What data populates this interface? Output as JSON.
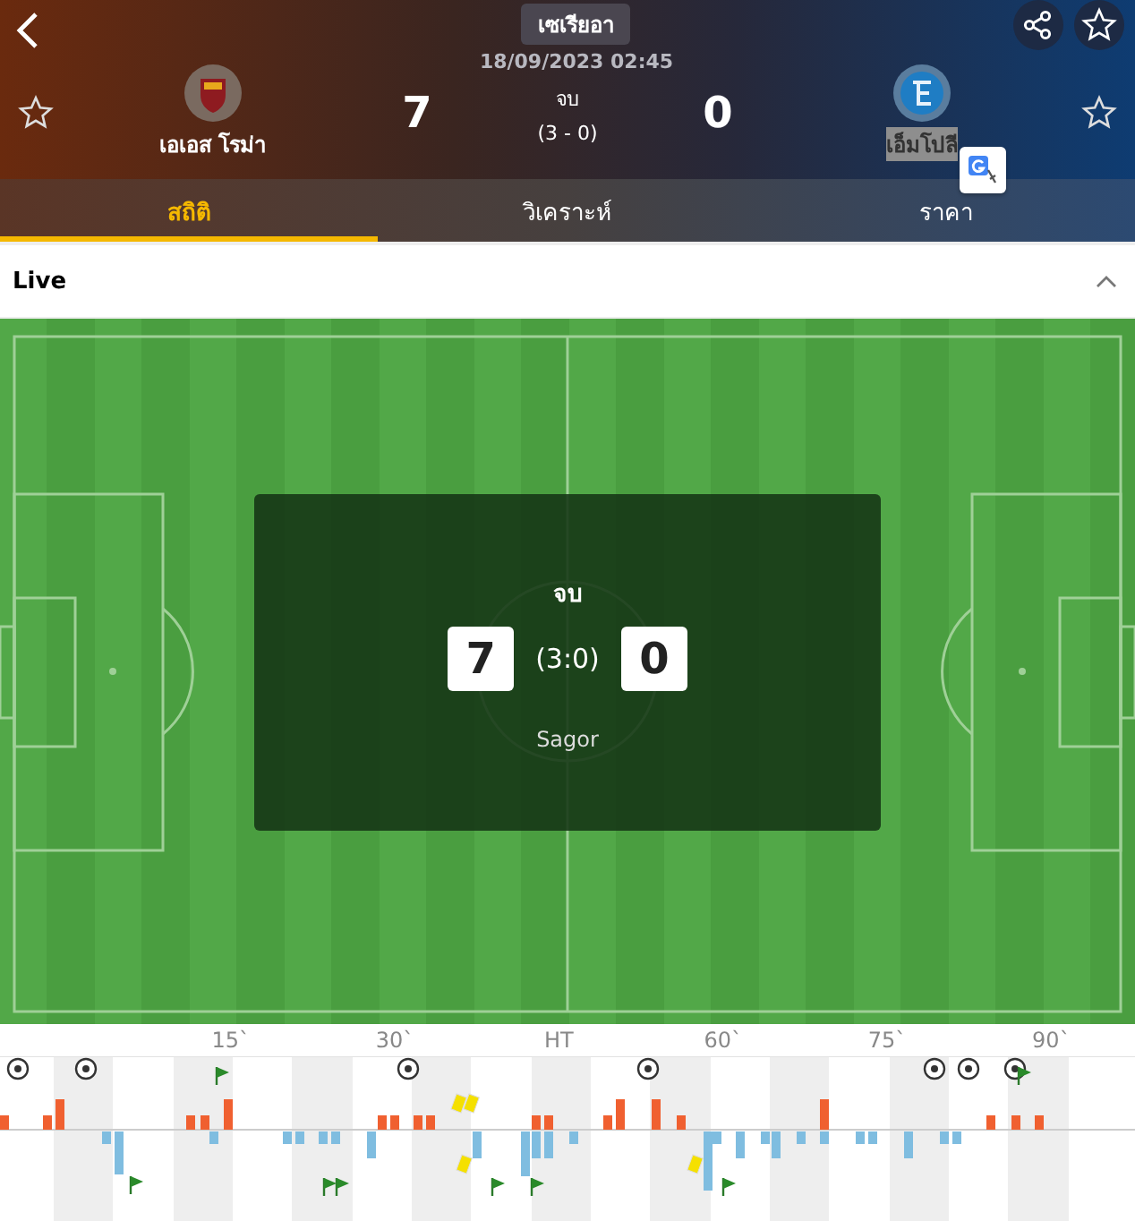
{
  "header": {
    "league": "เซเรียอา",
    "datetime": "18/09/2023 02:45",
    "home": {
      "name": "เอเอส โรม่า",
      "score": "7"
    },
    "away": {
      "name": "เอ็มโปลี",
      "score": "0",
      "highlighted": true
    },
    "status": "จบ",
    "half_time": "(3 - 0)"
  },
  "tabs": [
    {
      "label": "สถิติ",
      "selected": true
    },
    {
      "label": "วิเคราะห์",
      "selected": false
    },
    {
      "label": "ราคา",
      "selected": false
    }
  ],
  "live": {
    "title": "Live",
    "expanded": true
  },
  "pitch": {
    "status": "จบ",
    "home_score": "7",
    "half_time": "(3:0)",
    "away_score": "0",
    "venue": "Sagor"
  },
  "timeline": {
    "ticks": [
      "15`",
      "30`",
      "HT",
      "60`",
      "75`",
      "90`"
    ]
  }
}
